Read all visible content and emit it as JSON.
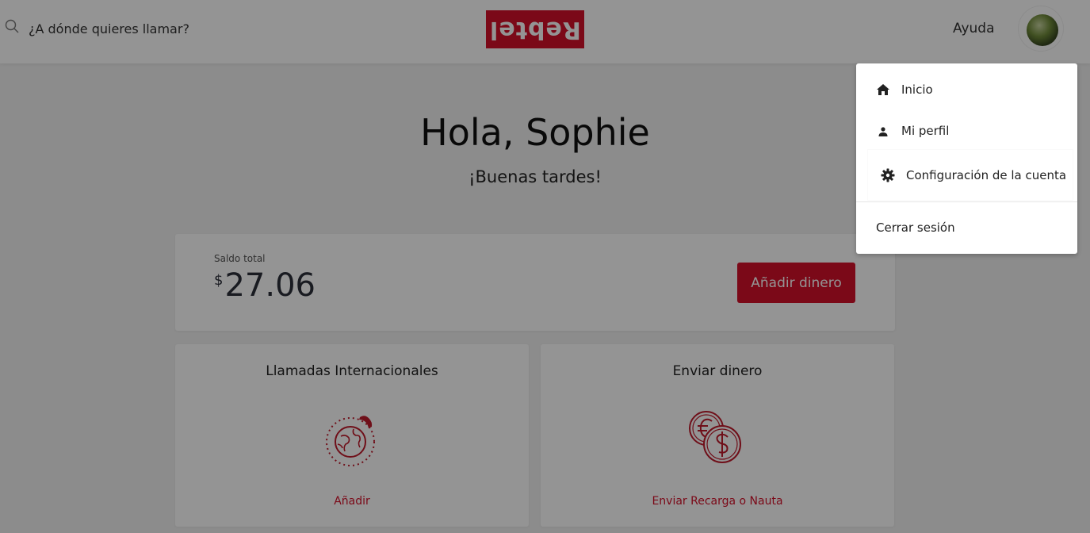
{
  "header": {
    "search_placeholder": "¿A dónde quieres llamar?",
    "logo_text": "Rebtel",
    "help_label": "Ayuda"
  },
  "main": {
    "greeting": "Hola, Sophie",
    "subgreeting": "¡Buenas tardes!",
    "balance": {
      "label": "Saldo total",
      "currency": "$",
      "amount": "27.06",
      "add_button": "Añadir dinero"
    },
    "services": [
      {
        "title": "Llamadas Internacionales",
        "icon": "globe-phone-icon",
        "link": "Añadir"
      },
      {
        "title": "Enviar dinero",
        "icon": "euro-dollar-coins-icon",
        "link": "Enviar Recarga o Nauta"
      }
    ]
  },
  "menu": {
    "items": [
      {
        "label": "Inicio",
        "icon": "home-icon"
      },
      {
        "label": "Mi perfil",
        "icon": "user-icon"
      },
      {
        "label": "Configuración de la cuenta",
        "icon": "gear-icon"
      },
      {
        "label": "Cerrar sesión"
      }
    ]
  },
  "colors": {
    "brand_red": "#d5112a",
    "background": "#f1f1f1",
    "overlay": "rgba(0,0,0,0.42)"
  }
}
